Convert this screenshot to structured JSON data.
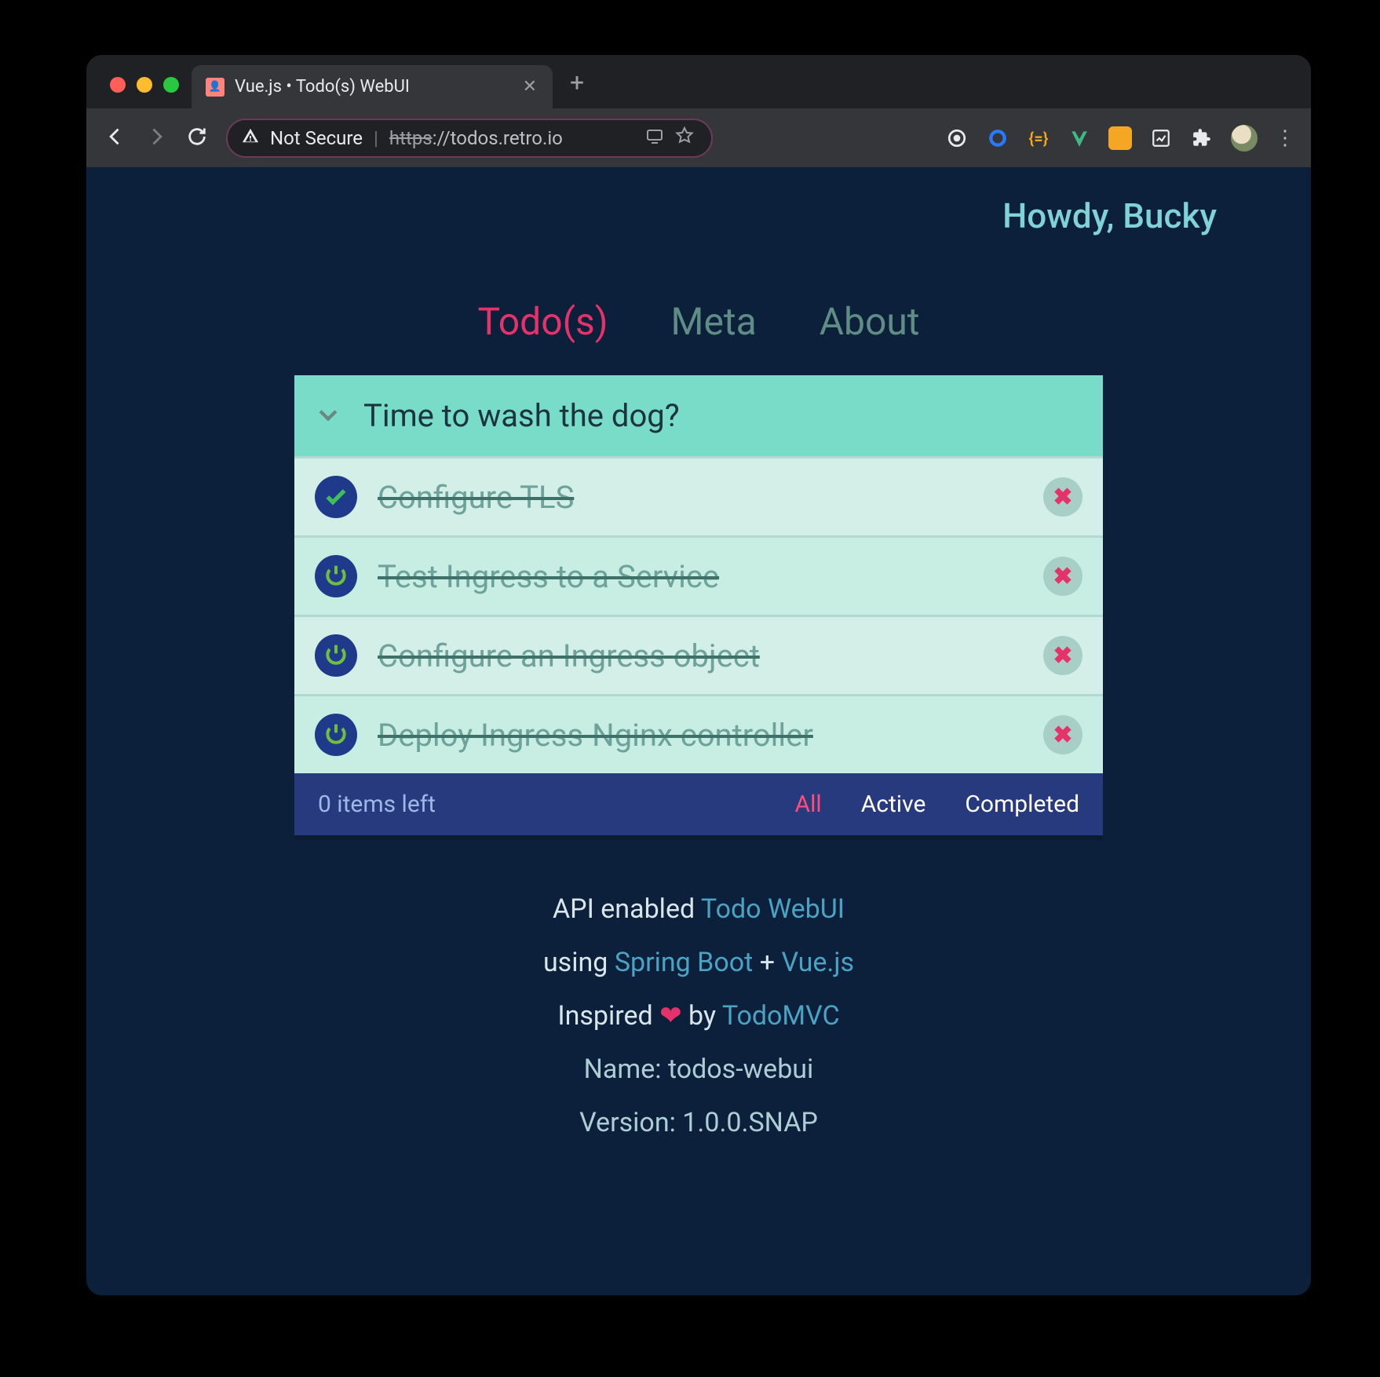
{
  "browser": {
    "tab_title": "Vue.js • Todo(s) WebUI",
    "security_label": "Not Secure",
    "url_scheme": "https",
    "url_rest": "://todos.retro.io"
  },
  "app": {
    "greeting": "Howdy, Bucky",
    "nav": {
      "todos": "Todo(s)",
      "meta": "Meta",
      "about": "About"
    },
    "new_todo_placeholder": "Time to wash the dog?",
    "todos": [
      {
        "text": "Configure TLS",
        "completed": true,
        "icon": "check"
      },
      {
        "text": "Test Ingress to a Service",
        "completed": true,
        "icon": "power"
      },
      {
        "text": "Configure an Ingress object",
        "completed": true,
        "icon": "power"
      },
      {
        "text": "Deploy Ingress-Nginx controller",
        "completed": true,
        "icon": "power"
      }
    ],
    "footer": {
      "count_text": "0 items left",
      "filters": {
        "all": "All",
        "active": "Active",
        "completed": "Completed"
      }
    },
    "meta": {
      "line1_prefix": "API enabled ",
      "line1_link": "Todo WebUI",
      "line2_prefix": "using ",
      "line2_link1": "Spring Boot",
      "line2_plus": " + ",
      "line2_link2": "Vue.js",
      "line3_prefix": "Inspired ",
      "line3_heart": "❤",
      "line3_by": " by ",
      "line3_link": "TodoMVC",
      "name_label": "Name: ",
      "name_value": "todos-webui",
      "version_label": "Version: ",
      "version_value": "1.0.0.SNAP"
    }
  },
  "colors": {
    "accent": "#e6326a",
    "bg": "#0c203b",
    "card": "#c8eee4",
    "header": "#79dcc9",
    "footer": "#283a7e"
  }
}
